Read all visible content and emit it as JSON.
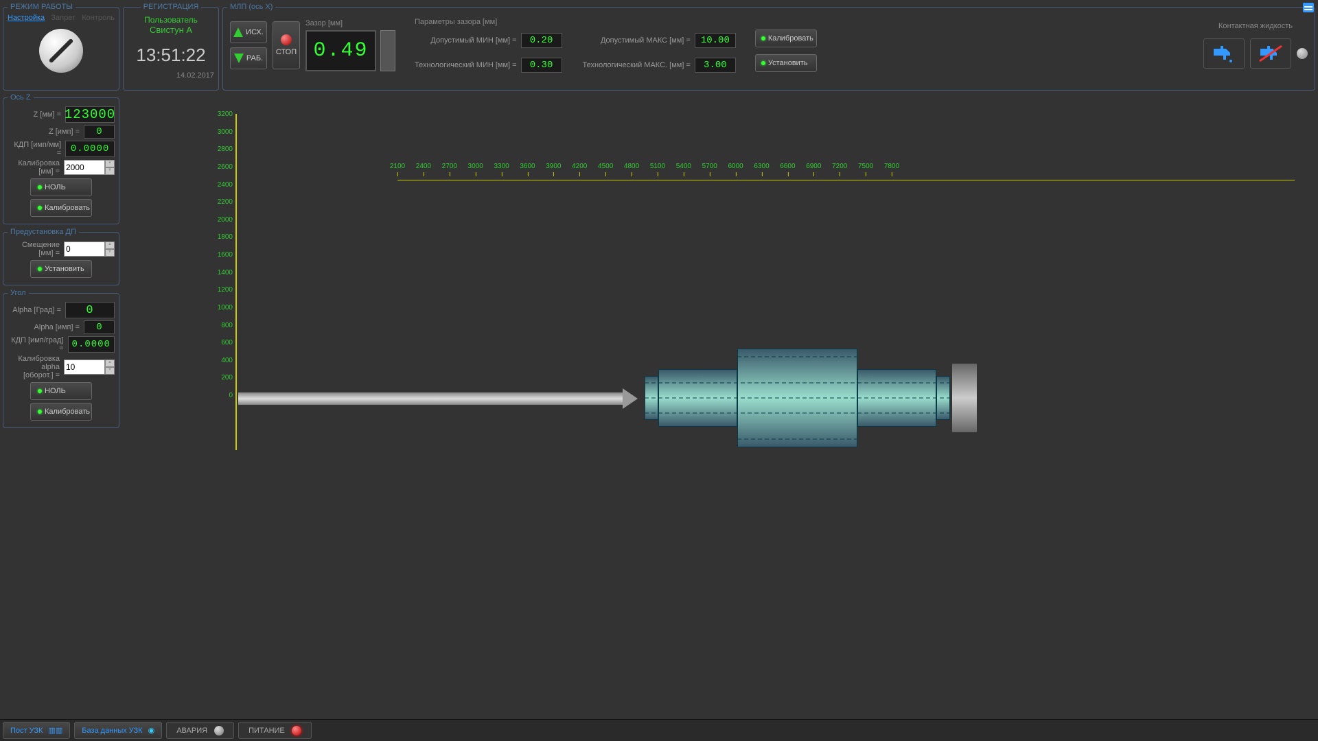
{
  "mode": {
    "legend": "РЕЖИМ РАБОТЫ",
    "tab_setup": "Настройка",
    "tab_block": "Запрет",
    "tab_ctrl": "Контроль"
  },
  "reg": {
    "legend": "РЕГИСТРАЦИЯ",
    "user_label": "Пользователь",
    "user_name": "Свистун А",
    "time": "13:51:22",
    "date": "14.02.2017"
  },
  "mlp": {
    "legend": "МЛП (ось X)",
    "btn_home": "ИСХ.",
    "btn_work": "РАБ.",
    "btn_stop": "СТОП",
    "gap_head": "Зазор [мм]",
    "gap_val": "0.49",
    "params_head": "Параметры зазора [мм]",
    "p_min_allow": "Допустимый МИН [мм] =",
    "p_min_allow_v": "0.20",
    "p_min_tech": "Технологический МИН [мм] =",
    "p_min_tech_v": "0.30",
    "p_max_allow": "Допустимый МАКС [мм] =",
    "p_max_allow_v": "10.00",
    "p_max_tech": "Технологический МАКС. [мм] =",
    "p_max_tech_v": "3.00",
    "btn_calib": "Калибровать",
    "btn_set": "Установить",
    "liquid_head": "Контактная жидкость"
  },
  "z": {
    "legend": "Ось Z",
    "l_mm": "Z [мм] =",
    "v_mm": "123000",
    "l_imp": "Z [имп] =",
    "v_imp": "0",
    "l_kdp": "КДП [имп/мм] =",
    "v_kdp": "0.0000",
    "l_calib": "Калибровка [мм] =",
    "v_calib": "2000",
    "btn_zero": "НОЛЬ",
    "btn_calib": "Калибровать"
  },
  "dp": {
    "legend": "Предустановка ДП",
    "l_off": "Смещение [мм] =",
    "v_off": "0",
    "btn_set": "Установить"
  },
  "ang": {
    "legend": "Угол",
    "l_deg": "Alpha [Град] =",
    "v_deg": "0",
    "l_imp": "Alpha [имп] =",
    "v_imp": "0",
    "l_kdp": "КДП [имп/град] =",
    "v_kdp": "0.0000",
    "l_cal1": "Калибровка alpha",
    "l_cal2": "[оборот.] =",
    "v_cal": "10",
    "btn_zero": "НОЛЬ",
    "btn_calib": "Калибровать"
  },
  "bottom": {
    "post": "Пост УЗК",
    "db": "База данных УЗК",
    "alarm": "АВАРИЯ",
    "power": "ПИТАНИЕ"
  },
  "chart_data": {
    "type": "line",
    "y_ticks": [
      0,
      200,
      400,
      600,
      800,
      1000,
      1200,
      1400,
      1600,
      1800,
      2000,
      2200,
      2400,
      2600,
      2800,
      3000,
      3200
    ],
    "x_ticks": [
      2100,
      2400,
      2700,
      3000,
      3300,
      3600,
      3900,
      4200,
      4500,
      4800,
      5100,
      5400,
      5700,
      6000,
      6300,
      6600,
      6900,
      7200,
      7500,
      7800
    ],
    "ylim": [
      0,
      3200
    ]
  }
}
